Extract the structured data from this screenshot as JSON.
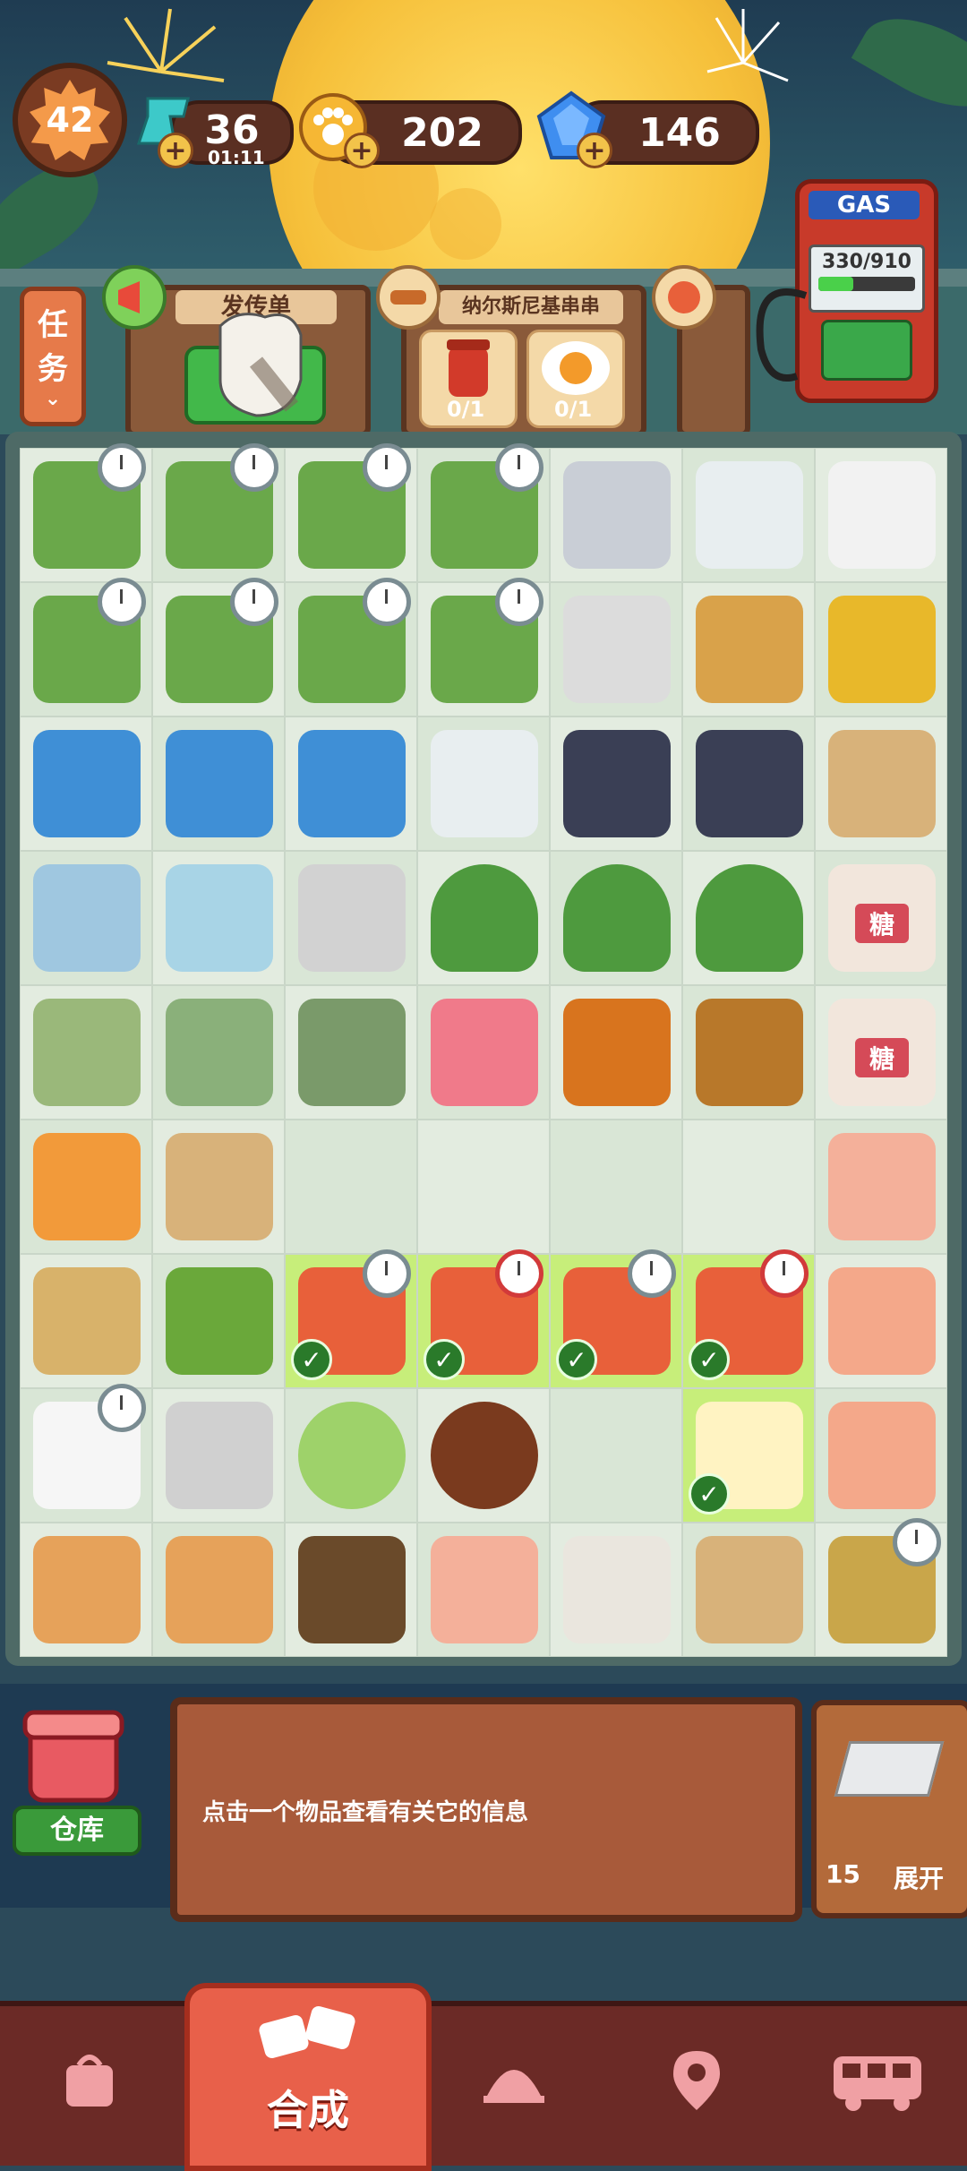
{
  "top_bar": {
    "level": "42",
    "energy": {
      "value": "36",
      "timer": "01:11",
      "icon": "lightning-energy-icon"
    },
    "coins": {
      "value": "202",
      "icon": "paw-coin-icon"
    },
    "gems": {
      "value": "146",
      "icon": "blue-gem-icon"
    },
    "plus_symbol": "+"
  },
  "gas_pump": {
    "label": "GAS",
    "capacity": "330/910",
    "fill_fraction": 0.36
  },
  "tasks": {
    "label_line1": "任",
    "label_line2": "务",
    "cards": [
      {
        "title": "发传单",
        "items": []
      },
      {
        "title": "纳尔斯尼基串串",
        "items": [
          {
            "name": "jam-jar",
            "progress": "0/1"
          },
          {
            "name": "fried-egg",
            "progress": "0/1"
          }
        ]
      }
    ]
  },
  "board": {
    "rows": [
      [
        "bamboo",
        "bamboo",
        "bamboo",
        "bamboo",
        "printer-large",
        "printer-small",
        "printer-mini"
      ],
      [
        "bamboo",
        "bamboo",
        "bamboo",
        "bamboo",
        "printer-white",
        "wooden-mallet",
        "pliers"
      ],
      [
        "notebook-sun",
        "notebook-sun",
        "notebook-sun",
        "notepad",
        "chef-hat",
        "chef-hat",
        "paper-bag-box"
      ],
      [
        "open-cabinet",
        "glass-cabinet",
        "safe-box",
        "tree",
        "tree",
        "tree",
        "sugar-jar"
      ],
      [
        "skewer-grill",
        "skewer-pot",
        "hot-pot",
        "pink-cup",
        "barrel-orange",
        "barrel-wood",
        "sugar-jar"
      ],
      [
        "layered-drink",
        "paper-bag-box",
        "empty",
        "empty",
        "empty",
        "empty",
        "pink-paper"
      ],
      [
        "beans-plate",
        "herb-board",
        "skewer-box",
        "skewer-box",
        "skewer-box",
        "skewer-box",
        "paper-plane"
      ],
      [
        "salt-jar",
        "grinding-bowl",
        "cabbage",
        "mushroom",
        "empty",
        "tofu",
        "crumpled-paper"
      ],
      [
        "shelf-bottles",
        "shelf-bottles",
        "shelf-rack",
        "pink-paper",
        "coffee-bag",
        "paper-bag-box",
        "drone-box"
      ]
    ],
    "sugar_char": "糖",
    "check_symbol": "✓"
  },
  "info": {
    "text": "点击一个物品查看有关它的信息",
    "warehouse_label": "仓库",
    "expand_count": "15",
    "expand_label": "展开"
  },
  "nav": {
    "merge_label": "合成",
    "items": [
      "shop-bag-icon",
      "merge-icon",
      "service-bell-icon",
      "map-pin-icon",
      "bus-icon"
    ]
  }
}
